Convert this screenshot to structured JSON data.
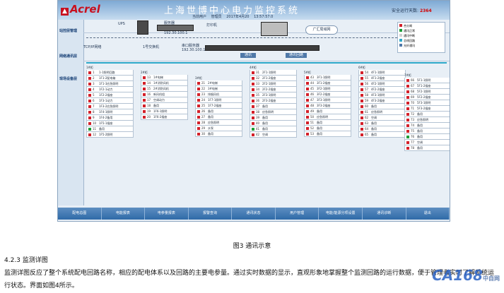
{
  "app": {
    "logo": "Acrel",
    "title": "上海世博中心电力监控系统",
    "header_info": [
      "当前用户",
      "管理员",
      "2017年4月20",
      "13:57:57.0"
    ],
    "alarm_label": "安全运行天数",
    "alarm_value": "2364"
  },
  "sidebar": [
    "站控层管理",
    "网络通讯层",
    "现场设备层"
  ],
  "equipment": {
    "ups": "UPS",
    "server": "服务器",
    "server_ip": "192.30.100.1",
    "printer": "打印机",
    "network": "广汇局域网",
    "switch_1": "1号交换机",
    "switch_ip": "192.30.100.10",
    "protocol": "TCP/IP网络",
    "port": "串口服务器",
    "port_ip": "192.30.100.11",
    "btn_1": "通讯",
    "btn_2": "通讯回路"
  },
  "legend": [
    {
      "color": "#d3202a",
      "label": "合分闸"
    },
    {
      "color": "#1e9e3a",
      "label": "通讯正常"
    },
    {
      "color": "#cfcfcf",
      "label": "通讯中断"
    },
    {
      "color": "#2da8c9",
      "label": "总线回路"
    },
    {
      "color": "#4f78a8",
      "label": "光纤通讯"
    }
  ],
  "panes": [
    {
      "title": "1#柜",
      "rows": [
        [
          "1",
          "1-1照明回路",
          "on"
        ],
        [
          "2",
          "1F1-2配电箱",
          "on"
        ],
        [
          "3",
          "1F1-3应急照明",
          "on"
        ],
        [
          "4",
          "1F2-1动力",
          "on"
        ],
        [
          "5",
          "1F2-2插座",
          "on"
        ],
        [
          "6",
          "1F3-1动力",
          "on"
        ],
        [
          "7",
          "1F3-2应急照明",
          "on"
        ],
        [
          "8",
          "1F4-1照明",
          "on"
        ],
        [
          "9",
          "1F4-2备用",
          "on"
        ],
        [
          "10",
          "1F5-1插座",
          "on"
        ],
        [
          "11",
          "备用",
          "off"
        ],
        [
          "12",
          "1F5-2照明",
          "on"
        ]
      ]
    },
    {
      "title": "2#柜",
      "rows": [
        [
          "13",
          "1#电梯",
          "on"
        ],
        [
          "14",
          "1#消防风机",
          "on"
        ],
        [
          "15",
          "2#消防风机",
          "on"
        ],
        [
          "16",
          "新风机组",
          "on"
        ],
        [
          "17",
          "空调动力",
          "on"
        ],
        [
          "18",
          "备用",
          "on"
        ],
        [
          "19",
          "1F6-1照明",
          "on"
        ],
        [
          "20",
          "1F6-2插座",
          "on"
        ]
      ]
    },
    {
      "title": "3#柜",
      "rows": [
        [
          "21",
          "2#电梯",
          "on"
        ],
        [
          "22",
          "3#电梯",
          "on"
        ],
        [
          "23",
          "排烟风机",
          "on"
        ],
        [
          "24",
          "1F7-1照明",
          "on"
        ],
        [
          "25",
          "1F7-2插座",
          "on"
        ],
        [
          "26",
          "备用",
          "on"
        ],
        [
          "27",
          "备用",
          "on"
        ],
        [
          "28",
          "应急照明",
          "on"
        ],
        [
          "29",
          "水泵",
          "on"
        ],
        [
          "30",
          "备用",
          "on"
        ]
      ]
    },
    {
      "title": "4#柜",
      "rows": [
        [
          "31",
          "2F1-1照明",
          "on"
        ],
        [
          "32",
          "2F1-2插座",
          "on"
        ],
        [
          "33",
          "2F2-1照明",
          "on"
        ],
        [
          "34",
          "2F2-2插座",
          "on"
        ],
        [
          "35",
          "2F3-1照明",
          "on"
        ],
        [
          "36",
          "2F3-2插座",
          "on"
        ],
        [
          "37",
          "备用",
          "on"
        ],
        [
          "38",
          "应急照明",
          "on"
        ],
        [
          "39",
          "备用",
          "on"
        ],
        [
          "40",
          "备用",
          "on"
        ],
        [
          "41",
          "备用",
          "off"
        ],
        [
          "42",
          "空调",
          "on"
        ]
      ]
    },
    {
      "title": "5#柜",
      "rows": [
        [
          "43",
          "3F1-1照明",
          "on"
        ],
        [
          "44",
          "3F1-2插座",
          "on"
        ],
        [
          "45",
          "3F2-1照明",
          "on"
        ],
        [
          "46",
          "3F2-2插座",
          "on"
        ],
        [
          "47",
          "3F3-1照明",
          "on"
        ],
        [
          "48",
          "3F3-2插座",
          "on"
        ],
        [
          "49",
          "备用",
          "on"
        ],
        [
          "50",
          "应急照明",
          "on"
        ],
        [
          "51",
          "备用",
          "on"
        ],
        [
          "52",
          "备用",
          "on"
        ],
        [
          "53",
          "备用",
          "on"
        ]
      ]
    },
    {
      "title": "6#柜",
      "rows": [
        [
          "54",
          "4F1-1照明",
          "on"
        ],
        [
          "55",
          "4F1-2插座",
          "on"
        ],
        [
          "56",
          "4F2-1照明",
          "on"
        ],
        [
          "57",
          "4F2-2插座",
          "on"
        ],
        [
          "58",
          "4F3-1照明",
          "on"
        ],
        [
          "59",
          "4F3-2插座",
          "on"
        ],
        [
          "60",
          "备用",
          "on"
        ],
        [
          "61",
          "应急照明",
          "on"
        ],
        [
          "62",
          "空调",
          "on"
        ],
        [
          "63",
          "备用",
          "on"
        ],
        [
          "64",
          "备用",
          "on"
        ],
        [
          "65",
          "备用",
          "on"
        ]
      ]
    },
    {
      "title": "7#柜",
      "rows": [
        [
          "66",
          "5F1-1照明",
          "on"
        ],
        [
          "67",
          "5F1-2插座",
          "on"
        ],
        [
          "68",
          "5F2-1照明",
          "on"
        ],
        [
          "69",
          "5F2-2插座",
          "on"
        ],
        [
          "70",
          "5F3-1照明",
          "on"
        ],
        [
          "71",
          "5F3-2插座",
          "on"
        ],
        [
          "72",
          "备用",
          "on"
        ],
        [
          "73",
          "应急照明",
          "on"
        ],
        [
          "74",
          "备用",
          "on"
        ],
        [
          "75",
          "备用",
          "on"
        ],
        [
          "76",
          "备用",
          "off"
        ],
        [
          "77",
          "空调",
          "on"
        ],
        [
          "78",
          "备用",
          "on"
        ]
      ]
    }
  ],
  "tabs": [
    "配电总图",
    "电能报表",
    "电参量报表",
    "报警查询",
    "通讯状态",
    "用户管理",
    "电能/能源分项设置",
    "通讯诊断",
    "退出"
  ],
  "caption": "图3 通讯示意",
  "section": "4.2.3 监测详图",
  "paragraph": "监测详图反应了整个系统配电回路名称，相应的配电体系以及回路的主要电参量。通过实时数据的显示，直观形象地掌握整个监测回路的运行数据，便于管理者实时了解系统运行状态。界面如图4所示。",
  "watermark": "CA168",
  "watermark_sub": "中自网"
}
